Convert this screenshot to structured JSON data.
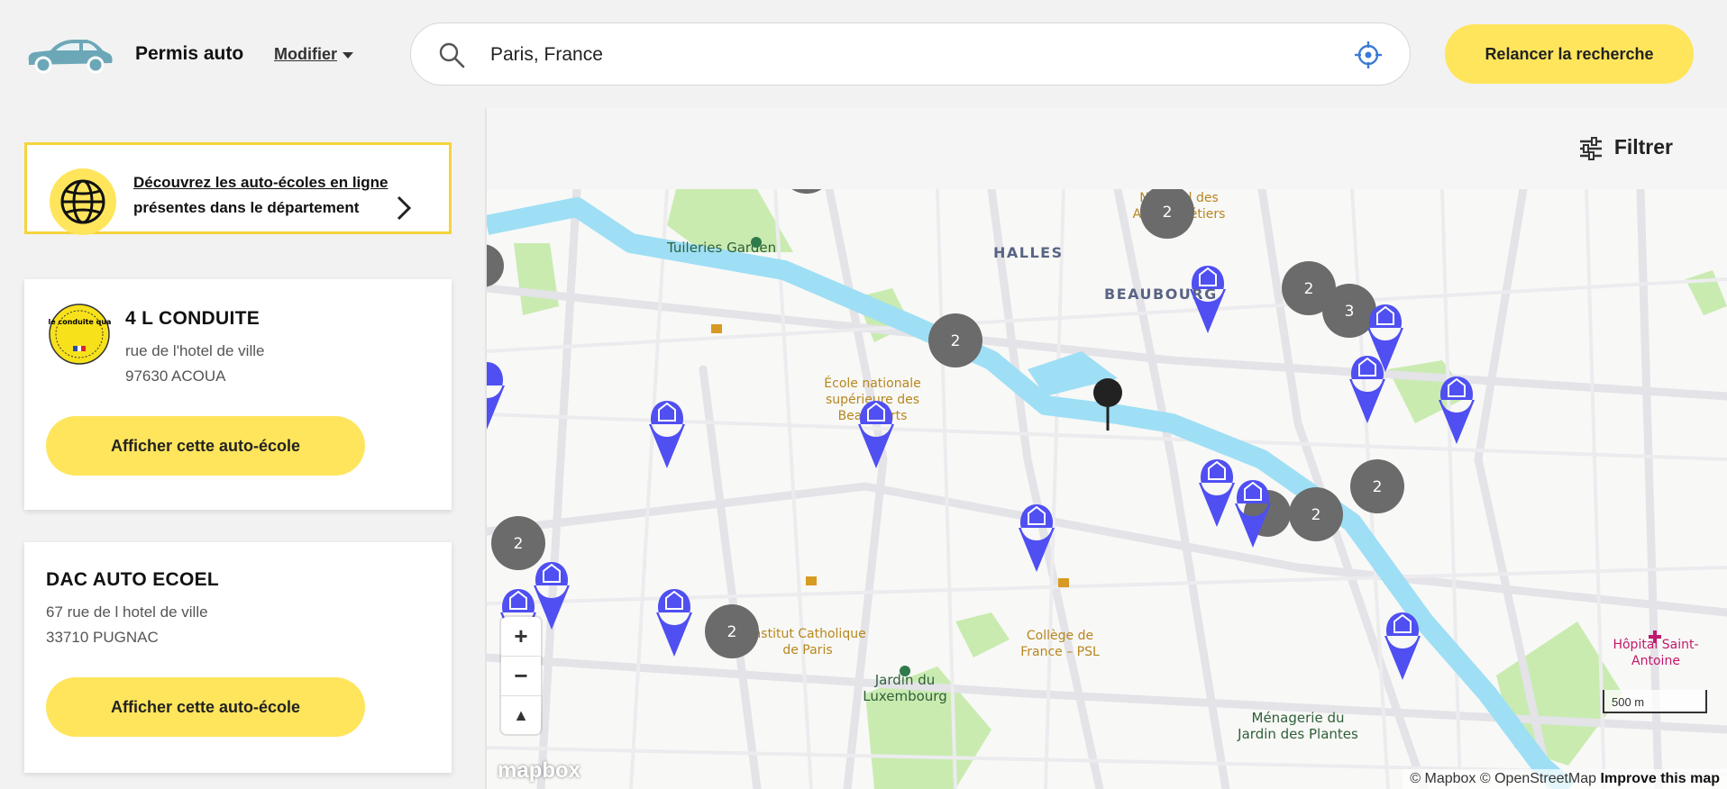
{
  "header": {
    "brand": "Permis auto",
    "modifier_label": "Modifier",
    "search_value": "Paris, France",
    "relaunch_label": "Relancer la recherche"
  },
  "promo": {
    "link_text": "Découvrez les auto-écoles en ligne",
    "rest_text": " présentes dans le département"
  },
  "schools": [
    {
      "name": "4 L CONDUITE",
      "street": "rue de l'hotel de ville",
      "city": "97630 ACOUA",
      "cta": "Afficher cette auto-école",
      "badge_text": "École conduite qualité"
    },
    {
      "name": "DAC AUTO ECOEL",
      "street": "67 rue de l hotel de ville",
      "city": "33710 PUGNAC",
      "cta": "Afficher cette auto-école"
    }
  ],
  "filter_label": "Filtrer",
  "map": {
    "labels": [
      "Tuileries Garden",
      "HALLES",
      "BEAUBOURG",
      "National des",
      "Arts et Métiers",
      "École nationale",
      "supérieure des",
      "Beaux-Arts",
      "Institut Catholique",
      "de Paris",
      "Collège de",
      "France – PSL",
      "Jardin du",
      "Luxembourg",
      "Ménagerie du",
      "Jardin des Plantes",
      "Hôpital Saint-",
      "Antoine"
    ],
    "clusters": [
      "2",
      "2",
      "2",
      "2",
      "3",
      "2",
      "2",
      "2",
      "2"
    ],
    "scale_label": "500 m",
    "zoom_in": "+",
    "zoom_out": "−",
    "compass": "▲",
    "mapbox_logo": "mapbox",
    "attribution": "© Mapbox © OpenStreetMap",
    "improve": "Improve this map"
  }
}
